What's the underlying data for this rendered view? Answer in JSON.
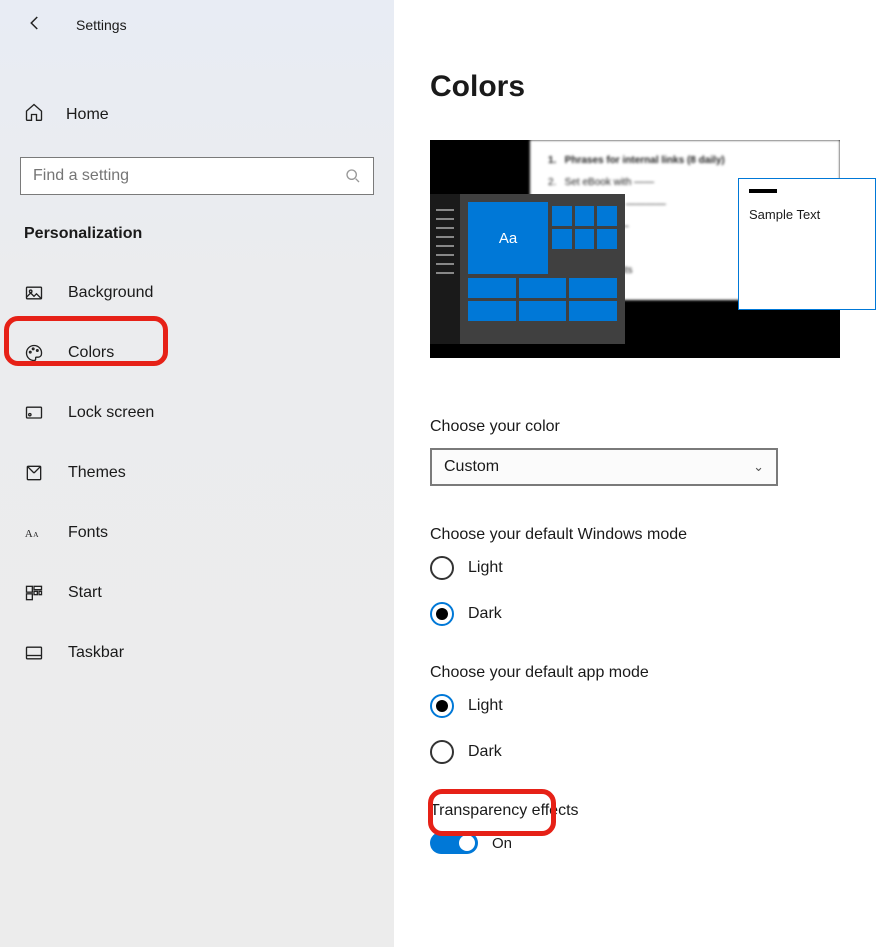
{
  "app": {
    "title": "Settings"
  },
  "sidebar": {
    "home": "Home",
    "search_placeholder": "Find a setting",
    "section": "Personalization",
    "items": [
      {
        "label": "Background"
      },
      {
        "label": "Colors"
      },
      {
        "label": "Lock screen"
      },
      {
        "label": "Themes"
      },
      {
        "label": "Fonts"
      },
      {
        "label": "Start"
      },
      {
        "label": "Taskbar"
      }
    ]
  },
  "main": {
    "title": "Colors",
    "preview": {
      "sample_text": "Sample Text",
      "tile_label": "Aa"
    },
    "choose_color": {
      "label": "Choose your color",
      "value": "Custom"
    },
    "windows_mode": {
      "label": "Choose your default Windows mode",
      "options": {
        "light": "Light",
        "dark": "Dark"
      },
      "selected": "dark"
    },
    "app_mode": {
      "label": "Choose your default app mode",
      "options": {
        "light": "Light",
        "dark": "Dark"
      },
      "selected": "light"
    },
    "transparency": {
      "label": "Transparency effects",
      "value": "On"
    }
  }
}
